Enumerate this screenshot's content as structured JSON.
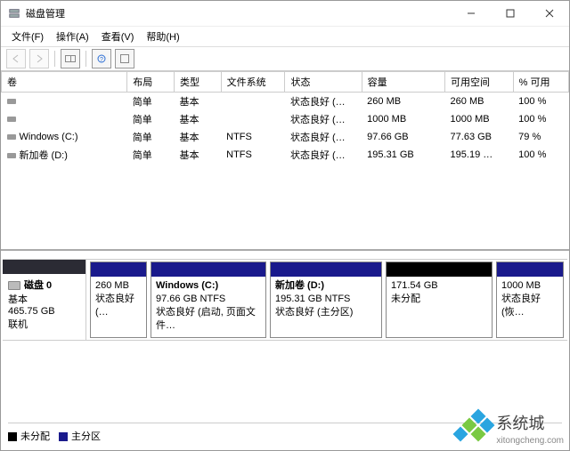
{
  "title": "磁盘管理",
  "menus": {
    "file": "文件(F)",
    "action": "操作(A)",
    "view": "查看(V)",
    "help": "帮助(H)"
  },
  "columns": {
    "volume": "卷",
    "layout": "布局",
    "type": "类型",
    "fs": "文件系统",
    "status": "状态",
    "capacity": "容量",
    "free": "可用空间",
    "pct": "% 可用"
  },
  "volumes": [
    {
      "name": "",
      "layout": "简单",
      "type": "基本",
      "fs": "",
      "status": "状态良好 (…",
      "capacity": "260 MB",
      "free": "260 MB",
      "pct": "100 %"
    },
    {
      "name": "",
      "layout": "简单",
      "type": "基本",
      "fs": "",
      "status": "状态良好 (…",
      "capacity": "1000 MB",
      "free": "1000 MB",
      "pct": "100 %"
    },
    {
      "name": "Windows (C:)",
      "layout": "简单",
      "type": "基本",
      "fs": "NTFS",
      "status": "状态良好 (…",
      "capacity": "97.66 GB",
      "free": "77.63 GB",
      "pct": "79 %"
    },
    {
      "name": "新加卷 (D:)",
      "layout": "简单",
      "type": "基本",
      "fs": "NTFS",
      "status": "状态良好 (…",
      "capacity": "195.31 GB",
      "free": "195.19 …",
      "pct": "100 %"
    }
  ],
  "disk": {
    "label": "磁盘 0",
    "type": "基本",
    "size": "465.75 GB",
    "state": "联机"
  },
  "parts": [
    {
      "name": "",
      "line2": "260 MB",
      "line3": "状态良好 (…",
      "kind": "primary"
    },
    {
      "name": "Windows  (C:)",
      "line2": "97.66 GB NTFS",
      "line3": "状态良好 (启动, 页面文件…",
      "kind": "primary"
    },
    {
      "name": "新加卷  (D:)",
      "line2": "195.31 GB NTFS",
      "line3": "状态良好 (主分区)",
      "kind": "primary"
    },
    {
      "name": "",
      "line2": "171.54 GB",
      "line3": "未分配",
      "kind": "unalloc"
    },
    {
      "name": "",
      "line2": "1000 MB",
      "line3": "状态良好 (恢…",
      "kind": "primary"
    }
  ],
  "legend": {
    "unalloc": "未分配",
    "primary": "主分区"
  },
  "brand": {
    "name": "系统城",
    "url": "xitongcheng.com"
  }
}
